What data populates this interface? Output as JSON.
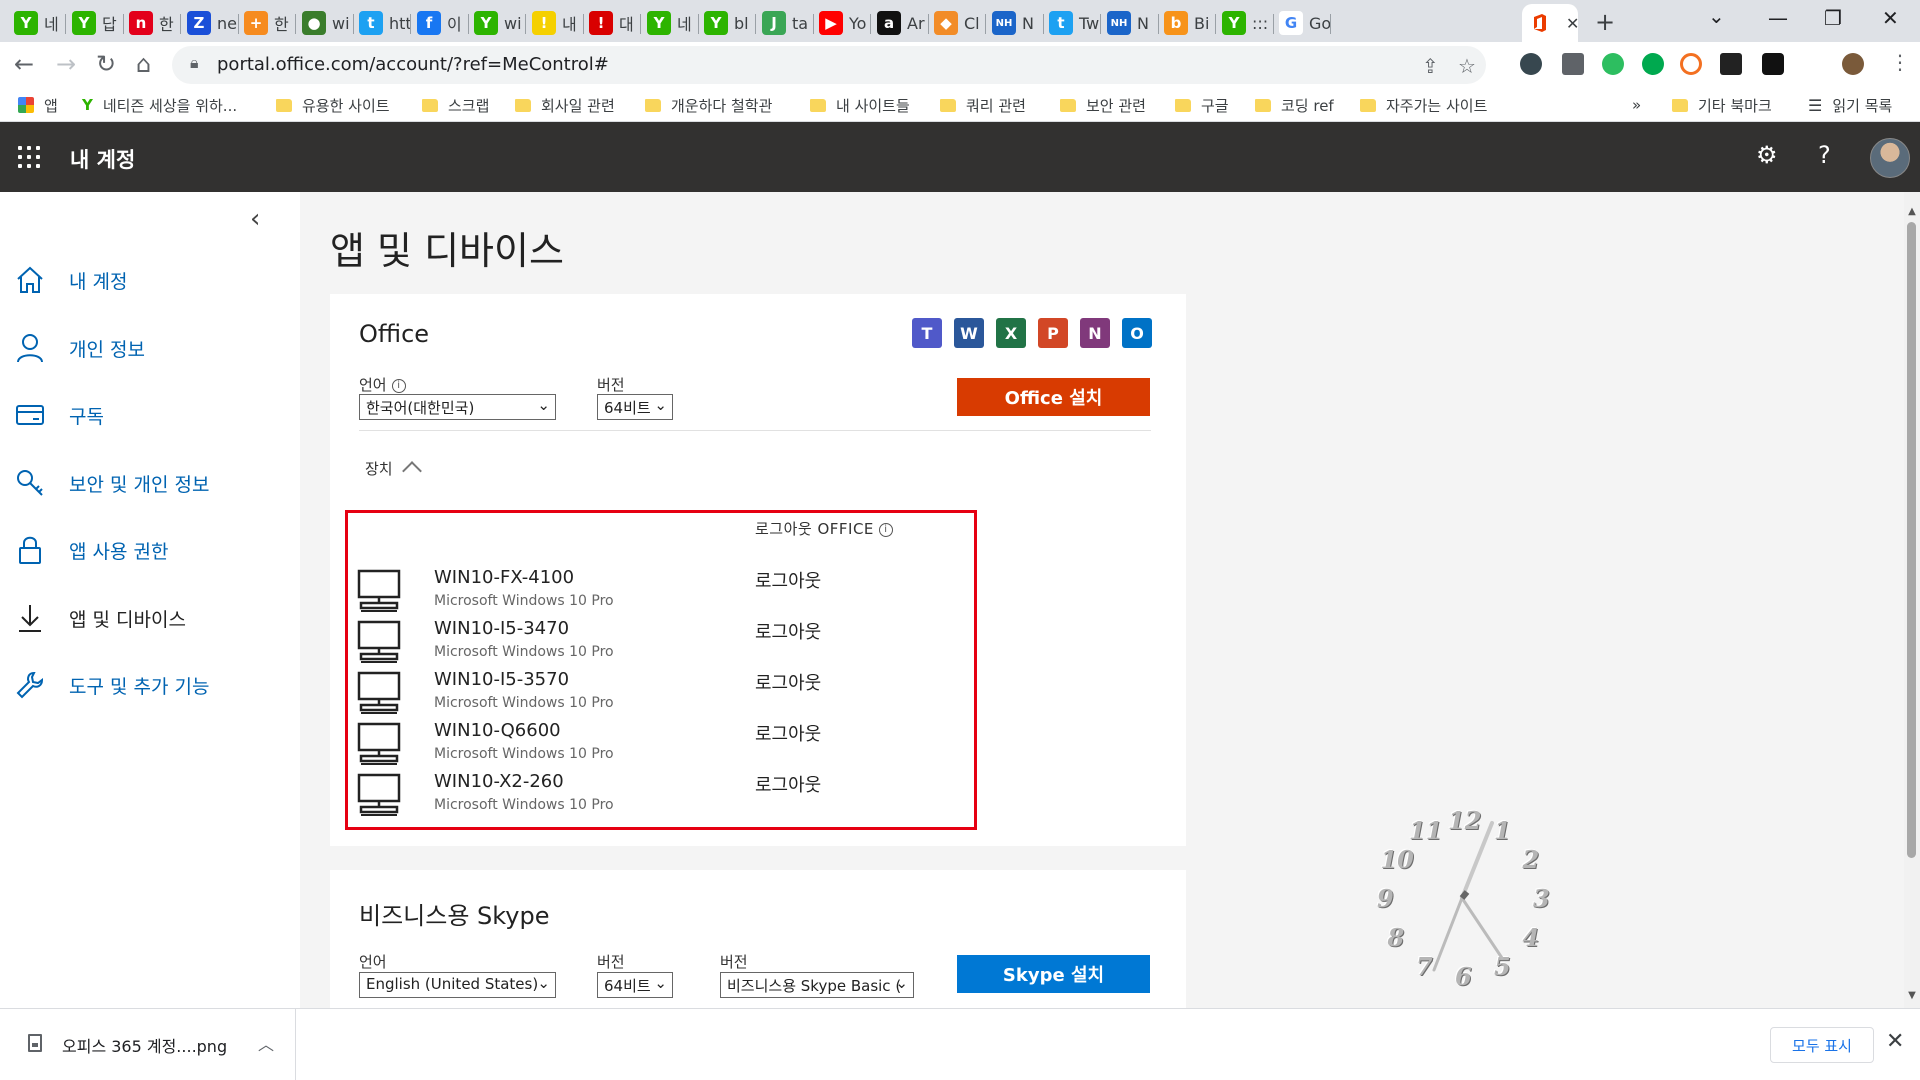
{
  "browser": {
    "tabs": [
      {
        "label": "네",
        "fav_color": "#2db400",
        "fav_glyph": "Y"
      },
      {
        "label": "답",
        "fav_color": "#2db400",
        "fav_glyph": "Y"
      },
      {
        "label": "한",
        "fav_color": "#e3001b",
        "fav_glyph": "n"
      },
      {
        "label": "ne",
        "fav_color": "#1a4fd8",
        "fav_glyph": "Z"
      },
      {
        "label": "한",
        "fav_color": "#f68b1f",
        "fav_glyph": "+"
      },
      {
        "label": "wi",
        "fav_color": "#3a7d2c",
        "fav_glyph": "●"
      },
      {
        "label": "htt",
        "fav_color": "#1da1f2",
        "fav_glyph": "t"
      },
      {
        "label": "이",
        "fav_color": "#1877f2",
        "fav_glyph": "f"
      },
      {
        "label": "wi",
        "fav_color": "#2db400",
        "fav_glyph": "Y"
      },
      {
        "label": "내",
        "fav_color": "#f5d000",
        "fav_glyph": "!"
      },
      {
        "label": "대",
        "fav_color": "#d90000",
        "fav_glyph": "!"
      },
      {
        "label": "네",
        "fav_color": "#2db400",
        "fav_glyph": "Y"
      },
      {
        "label": "bl",
        "fav_color": "#2db400",
        "fav_glyph": "Y"
      },
      {
        "label": "ta",
        "fav_color": "#3aa655",
        "fav_glyph": "J"
      },
      {
        "label": "Yo",
        "fav_color": "#ff0000",
        "fav_glyph": "▶"
      },
      {
        "label": "Ar",
        "fav_color": "#111111",
        "fav_glyph": "a"
      },
      {
        "label": "Cl",
        "fav_color": "#f28c28",
        "fav_glyph": "◆"
      },
      {
        "label": "N",
        "fav_color": "#1b65c9",
        "fav_glyph": "NH"
      },
      {
        "label": "Tw",
        "fav_color": "#1da1f2",
        "fav_glyph": "t"
      },
      {
        "label": "N",
        "fav_color": "#1b65c9",
        "fav_glyph": "NH"
      },
      {
        "label": "Bi",
        "fav_color": "#f7931a",
        "fav_glyph": "b"
      },
      {
        "label": ":::",
        "fav_color": "#2db400",
        "fav_glyph": "Y"
      },
      {
        "label": "Go",
        "fav_color": "#ffffff",
        "fav_glyph": "G"
      }
    ],
    "url": "portal.office.com/account/?ref=MeControl#",
    "bookmarks": [
      {
        "label": "앱",
        "type": "apps"
      },
      {
        "label": "네티즌 세상을 위하...",
        "type": "site"
      },
      {
        "label": "유용한 사이트",
        "type": "folder"
      },
      {
        "label": "스크랩",
        "type": "folder"
      },
      {
        "label": "회사일 관련",
        "type": "folder"
      },
      {
        "label": "개운하다 철학관",
        "type": "folder"
      },
      {
        "label": "내 사이트들",
        "type": "folder"
      },
      {
        "label": "쿼리 관련",
        "type": "folder"
      },
      {
        "label": "보안 관련",
        "type": "folder"
      },
      {
        "label": "구글",
        "type": "folder"
      },
      {
        "label": "코딩 ref",
        "type": "folder"
      },
      {
        "label": "자주가는 사이트",
        "type": "folder"
      }
    ],
    "bookmarks_overflow": "»",
    "other_bookmarks": "기타 북마크",
    "reading_list": "읽기 목록"
  },
  "header": {
    "title": "내 계정",
    "settings_icon": "gear-icon",
    "help_label": "?"
  },
  "nav": {
    "collapse_icon": "chevron-left-icon",
    "items": [
      {
        "label": "내 계정",
        "icon": "home-icon"
      },
      {
        "label": "개인 정보",
        "icon": "person-icon"
      },
      {
        "label": "구독",
        "icon": "card-icon"
      },
      {
        "label": "보안 및 개인 정보",
        "icon": "key-search-icon"
      },
      {
        "label": "앱 사용 권한",
        "icon": "lock-icon"
      },
      {
        "label": "앱 및 디바이스",
        "icon": "download-icon"
      },
      {
        "label": "도구 및 추가 기능",
        "icon": "wrench-icon"
      }
    ]
  },
  "page": {
    "title": "앱 및 디바이스"
  },
  "office": {
    "title": "Office",
    "apps": [
      {
        "name": "teams",
        "letter": "T",
        "color": "#5059c9"
      },
      {
        "name": "word",
        "letter": "W",
        "color": "#2b579a"
      },
      {
        "name": "excel",
        "letter": "X",
        "color": "#217346"
      },
      {
        "name": "powerpoint",
        "letter": "P",
        "color": "#d24726"
      },
      {
        "name": "onenote",
        "letter": "N",
        "color": "#80397b"
      },
      {
        "name": "outlook",
        "letter": "O",
        "color": "#0072c6"
      }
    ],
    "language_label": "언어",
    "language_value": "한국어(대한민국)",
    "version_label": "버전",
    "version_value": "64비트",
    "install_button": "Office 설치",
    "install_color": "#d83b01",
    "devices_label": "장치",
    "signout_header": "로그아웃 OFFICE",
    "devices": [
      {
        "name": "WIN10-FX-4100",
        "os": "Microsoft Windows 10 Pro",
        "action": "로그아웃"
      },
      {
        "name": "WIN10-I5-3470",
        "os": "Microsoft Windows 10 Pro",
        "action": "로그아웃"
      },
      {
        "name": "WIN10-I5-3570",
        "os": "Microsoft Windows 10 Pro",
        "action": "로그아웃"
      },
      {
        "name": "WIN10-Q6600",
        "os": "Microsoft Windows 10 Pro",
        "action": "로그아웃"
      },
      {
        "name": "WIN10-X2-260",
        "os": "Microsoft Windows 10 Pro",
        "action": "로그아웃"
      }
    ]
  },
  "skype": {
    "title": "비즈니스용 Skype",
    "language_label": "언어",
    "language_value": "English (United States)",
    "version_label": "버전",
    "version_value": "64비트",
    "edition_label": "버전",
    "edition_value": "비즈니스용 Skype Basic (",
    "install_button": "Skype 설치",
    "install_color": "#0078d4"
  },
  "clock": {
    "numbers": [
      "12",
      "1",
      "2",
      "3",
      "4",
      "5",
      "6",
      "7",
      "8",
      "9",
      "10",
      "11"
    ]
  },
  "downloads": {
    "file_name": "오피스 365 계정....png",
    "show_all": "모두 표시"
  },
  "colors": {
    "header_bg": "#323130",
    "nav_link": "#0063b1",
    "highlight_border": "#e60012"
  }
}
